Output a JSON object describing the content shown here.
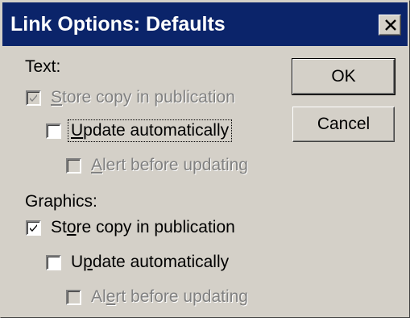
{
  "dialog": {
    "title": "Link Options: Defaults",
    "close_icon": "close-x-icon"
  },
  "text_group": {
    "label": "Text:",
    "options": [
      {
        "pre": "",
        "accel": "S",
        "post": "tore copy in publication",
        "checked": true,
        "enabled": false
      },
      {
        "pre": "",
        "accel": "U",
        "post": "pdate automatically",
        "checked": false,
        "enabled": true,
        "focused": true
      },
      {
        "pre": "",
        "accel": "A",
        "post": "lert before updating",
        "checked": false,
        "enabled": false
      }
    ]
  },
  "graphics_group": {
    "label": "Graphics:",
    "options": [
      {
        "pre": "St",
        "accel": "o",
        "post": "re copy in publication",
        "checked": true,
        "enabled": true
      },
      {
        "pre": "U",
        "accel": "p",
        "post": "date automatically",
        "checked": false,
        "enabled": true
      },
      {
        "pre": "Al",
        "accel": "e",
        "post": "rt before updating",
        "checked": false,
        "enabled": false
      }
    ]
  },
  "buttons": {
    "ok_label": "OK",
    "cancel_label": "Cancel"
  }
}
